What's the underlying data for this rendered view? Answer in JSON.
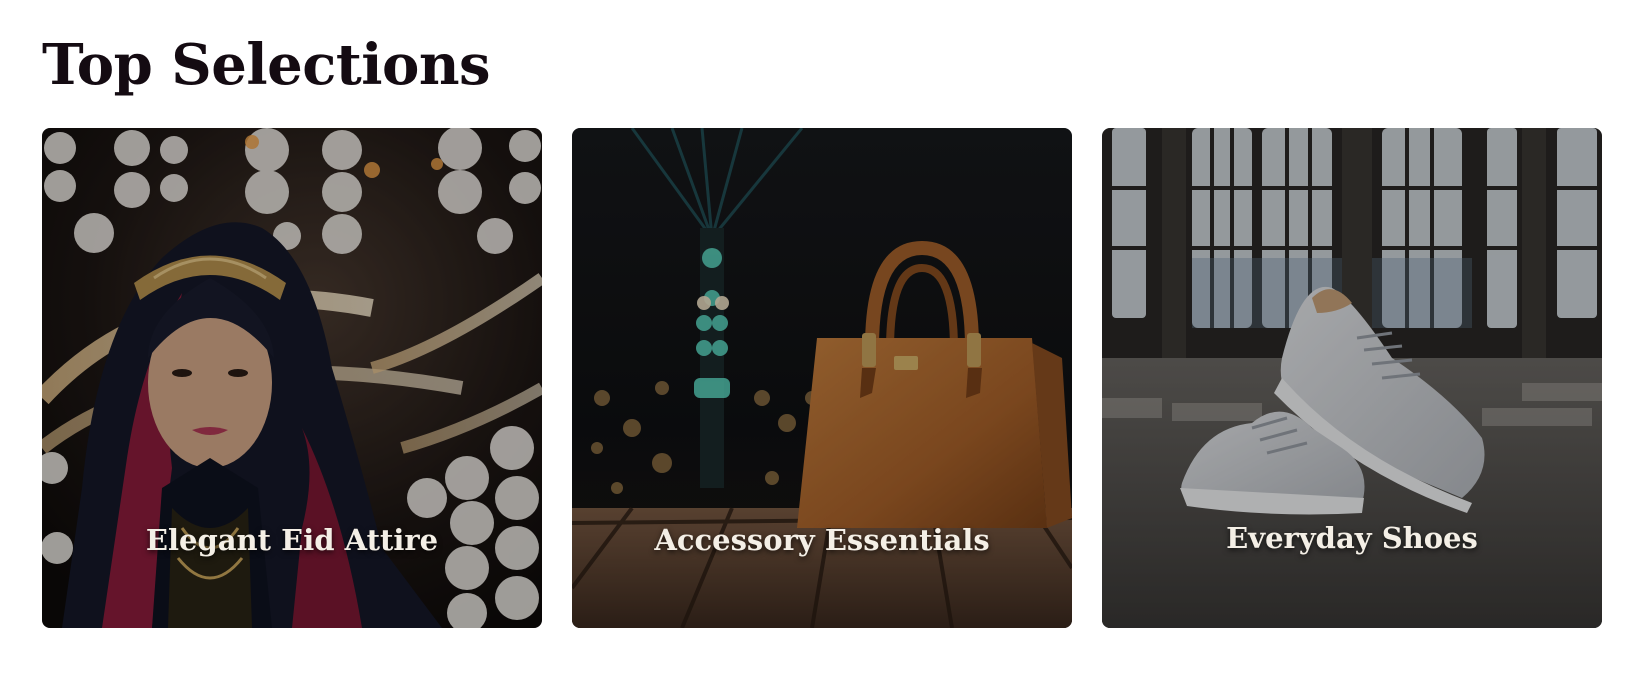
{
  "section": {
    "title": "Top Selections"
  },
  "cards": [
    {
      "label": "Elegant Eid Attire",
      "image": "woman-in-hijab-photo"
    },
    {
      "label": "Accessory Essentials",
      "image": "leather-handbag-photo"
    },
    {
      "label": "Everyday Shoes",
      "image": "white-sneakers-photo"
    }
  ],
  "colors": {
    "title": "#140b12",
    "card_label": "#f4efe6",
    "background": "#ffffff"
  }
}
